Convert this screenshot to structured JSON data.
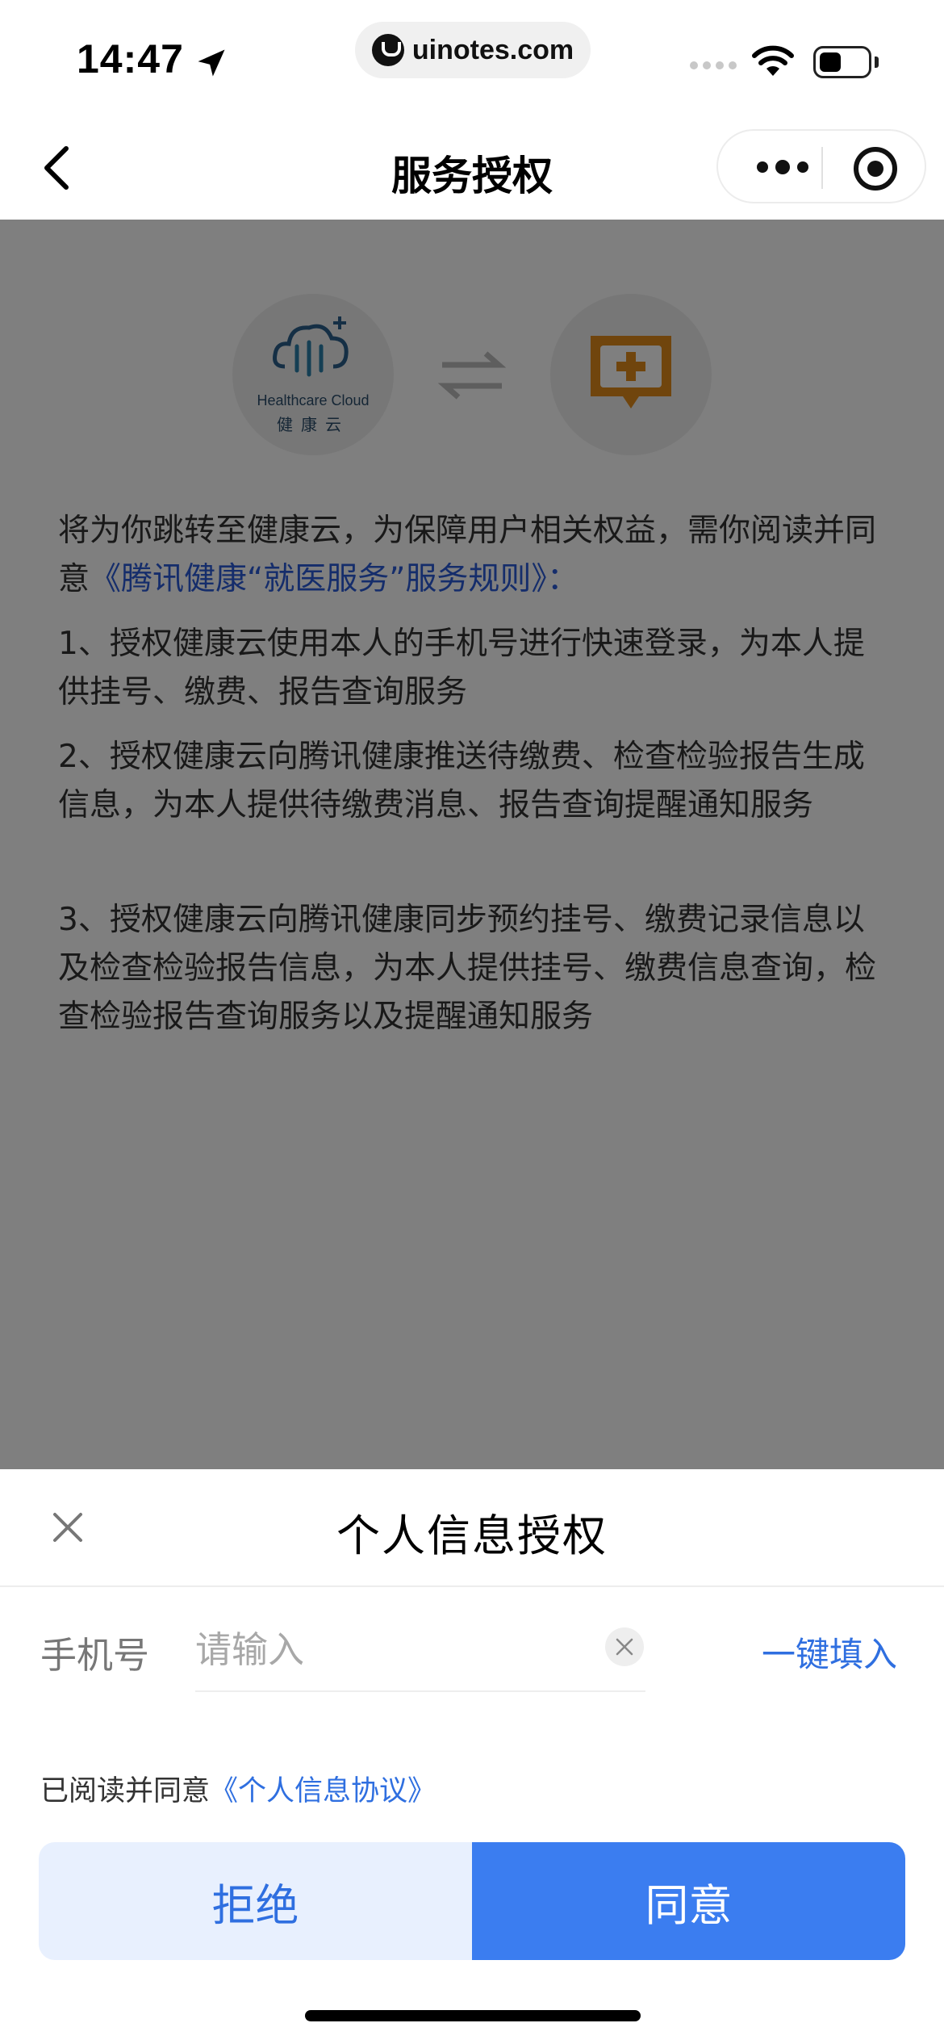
{
  "status_bar": {
    "time": "14:47",
    "url": "uinotes.com"
  },
  "nav": {
    "title": "服务授权"
  },
  "main": {
    "left_logo": {
      "caption_en": "Healthcare Cloud",
      "caption_cn": "健康云"
    },
    "intro": {
      "text": "将为你跳转至健康云，为保障用户相关权益，需你阅读并同意",
      "link": "《腾讯健康“就医服务”服务规则》",
      "suffix": "："
    },
    "items": [
      "1、授权健康云使用本人的手机号进行快速登录，为本人提供挂号、缴费、报告查询服务",
      "2、授权健康云向腾讯健康推送待缴费、检查检验报告生成信息，为本人提供待缴费消息、报告查询提醒通知服务",
      "3、授权健康云向腾讯健康同步预约挂号、缴费记录信息以及检查检验报告信息，为本人提供挂号、缴费信息查询，检查检验报告查询服务以及提醒通知服务"
    ]
  },
  "sheet": {
    "title": "个人信息授权",
    "phone_label": "手机号",
    "phone_placeholder": "请输入",
    "phone_value": "",
    "quick_fill": "一键填入",
    "agree_prefix": "已阅读并同意",
    "agree_link": "《个人信息协议》",
    "reject_label": "拒绝",
    "agree_label": "同意"
  },
  "colors": {
    "accent": "#3b7df0",
    "accent_light": "#e8f0fe",
    "link": "#2f6fe0",
    "overlay": "rgba(0,0,0,0.5)"
  },
  "icons": [
    "location-arrow-icon",
    "lock-icon",
    "wifi-icon",
    "battery-icon",
    "back-arrow-icon",
    "more-icon",
    "target-icon",
    "swap-icon",
    "close-icon",
    "clear-icon"
  ]
}
